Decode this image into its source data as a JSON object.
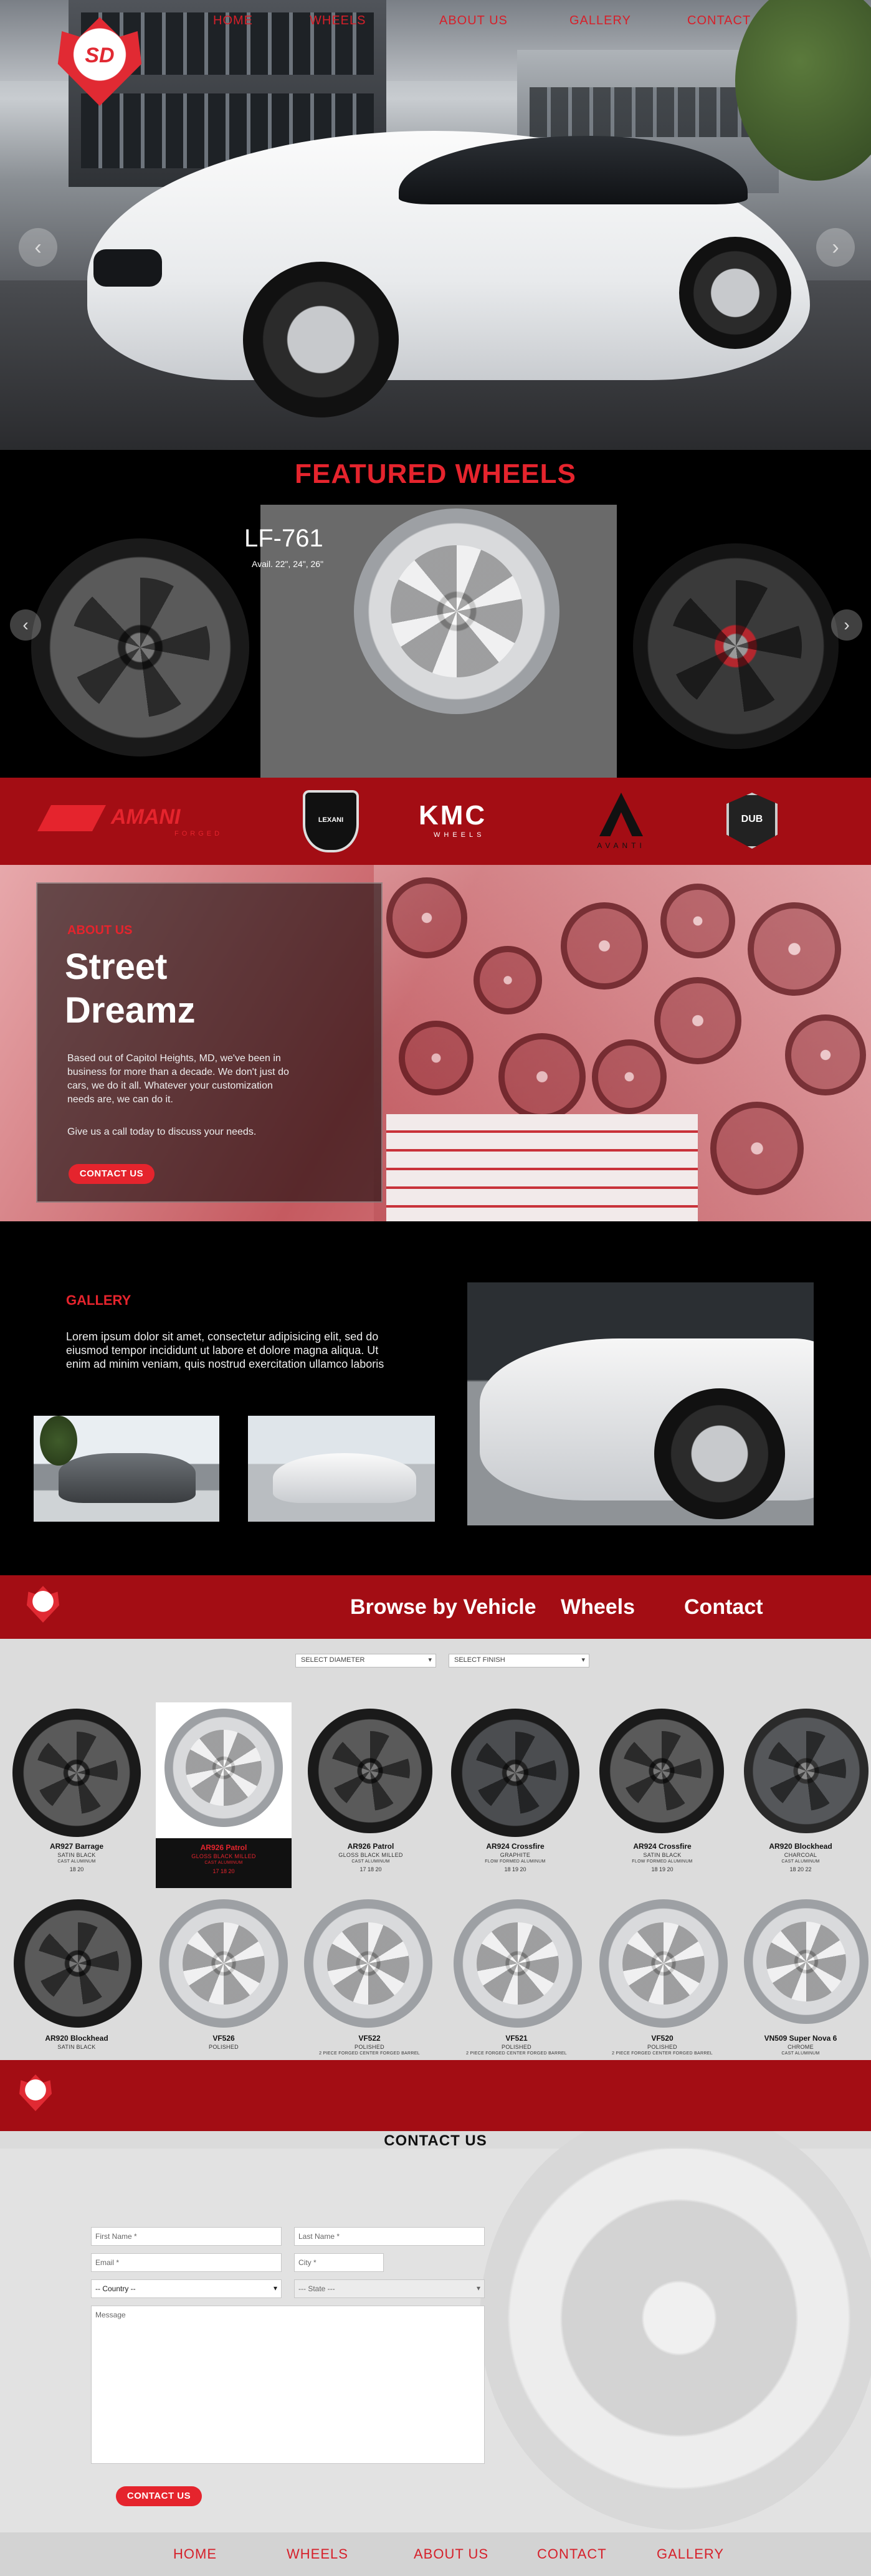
{
  "nav": {
    "home": "HOME",
    "wheels": "WHEELS",
    "about": "ABOUT US",
    "gallery": "GALLERY",
    "contact": "CONTACT"
  },
  "logo_text": "SD",
  "hero": {
    "prev_icon": "chevron-left-icon",
    "next_icon": "chevron-right-icon"
  },
  "featured": {
    "title": "FEATURED WHEELS",
    "wheel_name": "LF-761",
    "wheel_sizes": "Avail. 22\", 24\", 26\""
  },
  "brands": [
    "AMANI",
    "LEXANI",
    "KMC",
    "AVANTI",
    "DUB"
  ],
  "brand_subs": {
    "amani": "FORGED",
    "lexani": "LEXANI",
    "kmc": "WHEELS",
    "avanti": "AVANTI"
  },
  "about": {
    "eyebrow": "ABOUT US",
    "heading_line1": "Street",
    "heading_line2": "Dreamz",
    "para1": "Based out of Capitol Heights, MD, we've been in business for more than a decade. We don't just do cars, we do it all. Whatever your customization needs are, we can do it.",
    "para2": "Give us a call today to discuss your needs.",
    "cta": "CONTACT US"
  },
  "gallery": {
    "eyebrow": "GALLERY",
    "text": "Lorem ipsum dolor sit amet, consectetur adipisicing elit, sed do eiusmod tempor incididunt ut labore et dolore magna aliqua. Ut enim ad minim veniam, quis nostrud exercitation ullamco laboris"
  },
  "browse_nav": {
    "vehicle": "Browse by Vehicle",
    "wheels": "Wheels",
    "contact": "Contact"
  },
  "filters": {
    "diameter": "SELECT DIAMETER",
    "finish": "SELECT FINISH"
  },
  "products_row1": [
    {
      "name": "AR927 Barrage",
      "finish": "SATIN BLACK",
      "sub": "CAST ALUMINUM",
      "sizes": "18  20"
    },
    {
      "name": "AR926 Patrol",
      "finish": "GLOSS BLACK MILLED",
      "sub": "CAST ALUMINUM",
      "sizes": "17  18  20"
    },
    {
      "name": "AR926 Patrol",
      "finish": "GLOSS BLACK MILLED",
      "sub": "CAST ALUMINUM",
      "sizes": "17  18  20"
    },
    {
      "name": "AR924 Crossfire",
      "finish": "GRAPHITE",
      "sub": "FLOW FORMED ALUMINUM",
      "sizes": "18  19  20"
    },
    {
      "name": "AR924 Crossfire",
      "finish": "SATIN BLACK",
      "sub": "FLOW FORMED ALUMINUM",
      "sizes": "18  19  20"
    },
    {
      "name": "AR920 Blockhead",
      "finish": "CHARCOAL",
      "sub": "CAST ALUMINUM",
      "sizes": "18  20  22"
    }
  ],
  "products_row2": [
    {
      "name": "AR920 Blockhead",
      "finish": "SATIN BLACK",
      "sub": ""
    },
    {
      "name": "VF526",
      "finish": "POLISHED",
      "sub": ""
    },
    {
      "name": "VF522",
      "finish": "POLISHED",
      "sub": "2 PIECE FORGED CENTER FORGED BARREL"
    },
    {
      "name": "VF521",
      "finish": "POLISHED",
      "sub": "2 PIECE FORGED CENTER FORGED BARREL"
    },
    {
      "name": "VF520",
      "finish": "POLISHED",
      "sub": "2 PIECE FORGED CENTER FORGED BARREL"
    },
    {
      "name": "VN509 Super Nova 6",
      "finish": "CHROME",
      "sub": "CAST ALUMINUM"
    }
  ],
  "contact": {
    "title": "CONTACT US",
    "first_name": "First Name *",
    "last_name": "Last Name *",
    "email": "Email *",
    "city": "City *",
    "country": "-- Country --",
    "state": "--- State ---",
    "message": "Message",
    "submit": "CONTACT US"
  },
  "footer": {
    "home": "HOME",
    "wheels": "WHEELS",
    "about": "ABOUT US",
    "contact": "CONTACT",
    "gallery": "GALLERY"
  },
  "colors": {
    "brand_red": "#a30d14",
    "accent_red": "#e5242d"
  }
}
